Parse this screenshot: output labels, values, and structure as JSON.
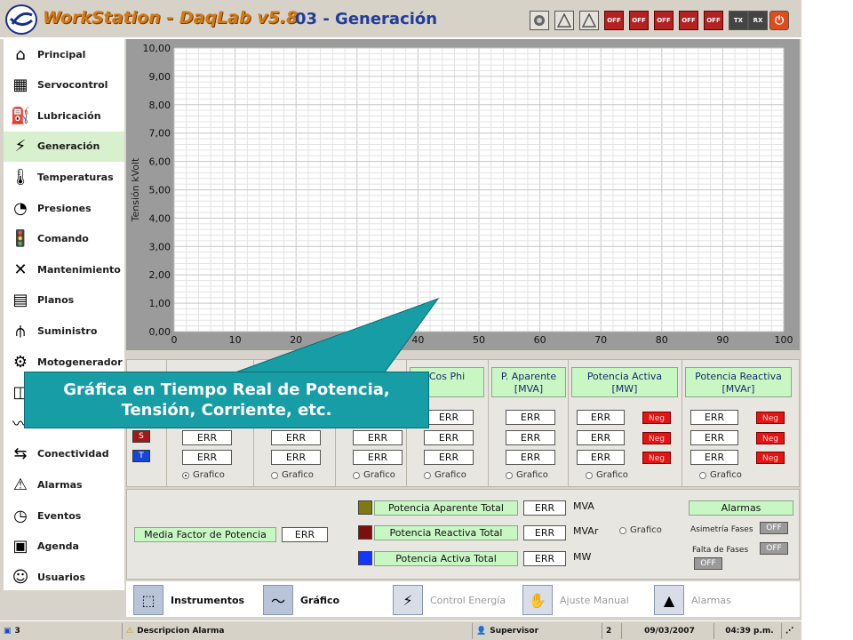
{
  "app": {
    "title": "WorkStation - DaqLab v5.8",
    "screen_title": "03 - Generación"
  },
  "toolbar": {
    "off_label": "OFF",
    "tx_label": "TX",
    "rx_label": "RX"
  },
  "sidebar": {
    "items": [
      {
        "label": "Principal",
        "icon": "home-icon"
      },
      {
        "label": "Servocontrol",
        "icon": "servo-icon"
      },
      {
        "label": "Lubricación",
        "icon": "oil-can-icon"
      },
      {
        "label": "Generación",
        "icon": "lightning-icon",
        "active": true
      },
      {
        "label": "Temperaturas",
        "icon": "thermometer-icon"
      },
      {
        "label": "Presiones",
        "icon": "gauge-icon"
      },
      {
        "label": "Comando",
        "icon": "traffic-light-icon"
      },
      {
        "label": "Mantenimiento",
        "icon": "tools-icon"
      },
      {
        "label": "Planos",
        "icon": "blueprint-icon"
      },
      {
        "label": "Suministro",
        "icon": "power-tower-icon"
      },
      {
        "label": "Motogenerador",
        "icon": "generator-icon"
      },
      {
        "label": "",
        "icon": "chart-icon"
      },
      {
        "label": "",
        "icon": "vibration-icon"
      },
      {
        "label": "Conectividad",
        "icon": "connection-icon"
      },
      {
        "label": "Alarmas",
        "icon": "warning-icon"
      },
      {
        "label": "Eventos",
        "icon": "clock-icon"
      },
      {
        "label": "Agenda",
        "icon": "calendar-icon"
      },
      {
        "label": "Usuarios",
        "icon": "users-icon"
      }
    ]
  },
  "chart_data": {
    "type": "line",
    "ylabel": "Tensión kVolt",
    "xlabel": "",
    "xlim": [
      0,
      100
    ],
    "ylim": [
      0,
      10
    ],
    "x_ticks": [
      "0",
      "10",
      "20",
      "30",
      "40",
      "50",
      "60",
      "70",
      "80",
      "90",
      "100"
    ],
    "y_ticks": [
      "0,00",
      "1,00",
      "2,00",
      "3,00",
      "4,00",
      "5,00",
      "6,00",
      "7,00",
      "8,00",
      "9,00",
      "10,00"
    ],
    "grid": true,
    "series": []
  },
  "measurements": {
    "phases": [
      "S",
      "T"
    ],
    "phase_colors": {
      "S": "#9e1b1b",
      "T": "#1646d8"
    },
    "grafico_label": "Grafico",
    "err": "ERR",
    "neg": "Neg",
    "columns": [
      {
        "header": "",
        "values": [
          "ERR",
          "ERR"
        ]
      },
      {
        "header": "",
        "values": [
          "ERR",
          "ERR"
        ]
      },
      {
        "header": "",
        "values": [
          "ERR",
          "ERR"
        ]
      },
      {
        "header": "Cos Phi",
        "values": [
          "ERR",
          "ERR",
          "ERR"
        ]
      },
      {
        "header": "P. Aparente\n[MVA]",
        "values": [
          "ERR",
          "ERR",
          "ERR"
        ]
      },
      {
        "header": "Potencia Activa\n[MW]",
        "values": [
          "ERR",
          "ERR",
          "ERR"
        ]
      },
      {
        "header": "Potencia Reactiva\n[MVAr]",
        "values": [
          "ERR",
          "ERR",
          "ERR"
        ]
      }
    ]
  },
  "totals": {
    "media_label": "Media Factor de Potencia",
    "media_value": "ERR",
    "rows": [
      {
        "label": "Potencia Aparente Total",
        "value": "ERR",
        "unit": "MVA",
        "color": "#7f7a10"
      },
      {
        "label": "Potencia Reactiva Total",
        "value": "ERR",
        "unit": "MVAr",
        "color": "#7d0e0e"
      },
      {
        "label": "Potencia Activa Total",
        "value": "ERR",
        "unit": "MW",
        "color": "#1436ff"
      }
    ],
    "grafico_label": "Grafico",
    "alarmas_label": "Alarmas",
    "asimetria_label": "Asimetría Fases",
    "falta_label": "Falta de Fases",
    "off_label": "OFF"
  },
  "tabs": [
    {
      "label": "Instrumentos",
      "icon": "instruments-icon",
      "enabled": true
    },
    {
      "label": "Gráfico",
      "icon": "graph-icon",
      "enabled": true
    },
    {
      "label": "Control Energía",
      "icon": "energy-icon",
      "enabled": false
    },
    {
      "label": "Ajuste Manual",
      "icon": "hand-icon",
      "enabled": false
    },
    {
      "label": "Alarmas",
      "icon": "bell-icon",
      "enabled": false
    }
  ],
  "status": {
    "alarm_count": "3",
    "alarm_desc": "Descripcion Alarma",
    "user": "Supervisor",
    "level": "2",
    "date": "09/03/2007",
    "time": "04:39 p.m."
  },
  "callout": {
    "text": "Gráfica en Tiempo Real de Potencia, Tensión, Corriente, etc."
  }
}
